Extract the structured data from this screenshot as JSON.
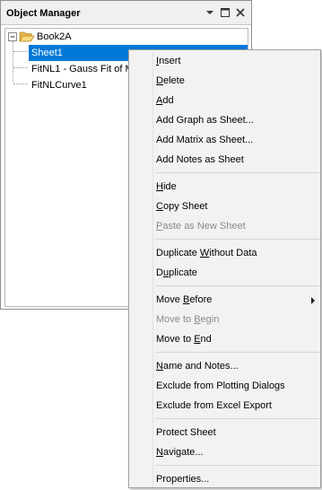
{
  "panel": {
    "title": "Object Manager",
    "controls": [
      "dropdown-arrow",
      "maximize",
      "close"
    ],
    "tree": {
      "workbook": "Book2A",
      "sheets": [
        {
          "label": "Sheet1",
          "selected": true
        },
        {
          "label": "FitNL1 - Gauss Fit of M",
          "selected": false
        },
        {
          "label": "FitNLCurve1",
          "selected": false
        }
      ]
    }
  },
  "menu": {
    "items": [
      {
        "pre": "",
        "key": "I",
        "post": "nsert",
        "disabled": false
      },
      {
        "pre": "",
        "key": "D",
        "post": "elete",
        "disabled": false
      },
      {
        "pre": "",
        "key": "A",
        "post": "dd",
        "disabled": false
      },
      {
        "pre": "Add Graph as Sheet...",
        "key": "",
        "post": "",
        "disabled": false
      },
      {
        "pre": "Add Matrix as Sheet...",
        "key": "",
        "post": "",
        "disabled": false
      },
      {
        "pre": "Add Notes as Sheet",
        "key": "",
        "post": "",
        "disabled": false
      },
      {
        "pre": "",
        "key": "H",
        "post": "ide",
        "disabled": false
      },
      {
        "pre": "",
        "key": "C",
        "post": "opy Sheet",
        "disabled": false
      },
      {
        "pre": "",
        "key": "P",
        "post": "aste as New Sheet",
        "disabled": true
      },
      {
        "pre": "Duplicate ",
        "key": "W",
        "post": "ithout Data",
        "disabled": false
      },
      {
        "pre": "D",
        "key": "u",
        "post": "plicate",
        "disabled": false
      },
      {
        "pre": "Move ",
        "key": "B",
        "post": "efore",
        "disabled": false,
        "submenu": true
      },
      {
        "pre": "Move to ",
        "key": "B",
        "post": "egin",
        "disabled": true
      },
      {
        "pre": "Move to ",
        "key": "E",
        "post": "nd",
        "disabled": false
      },
      {
        "pre": "",
        "key": "N",
        "post": "ame and Notes...",
        "disabled": false
      },
      {
        "pre": "Exclude from Plotting Dialogs",
        "key": "",
        "post": "",
        "disabled": false
      },
      {
        "pre": "Exclude from Excel Export",
        "key": "",
        "post": "",
        "disabled": false
      },
      {
        "pre": "Protect Sheet",
        "key": "",
        "post": "",
        "disabled": false
      },
      {
        "pre": "",
        "key": "N",
        "post": "avigate...",
        "disabled": false
      },
      {
        "pre": "Properties...",
        "key": "",
        "post": "",
        "disabled": false
      }
    ]
  }
}
